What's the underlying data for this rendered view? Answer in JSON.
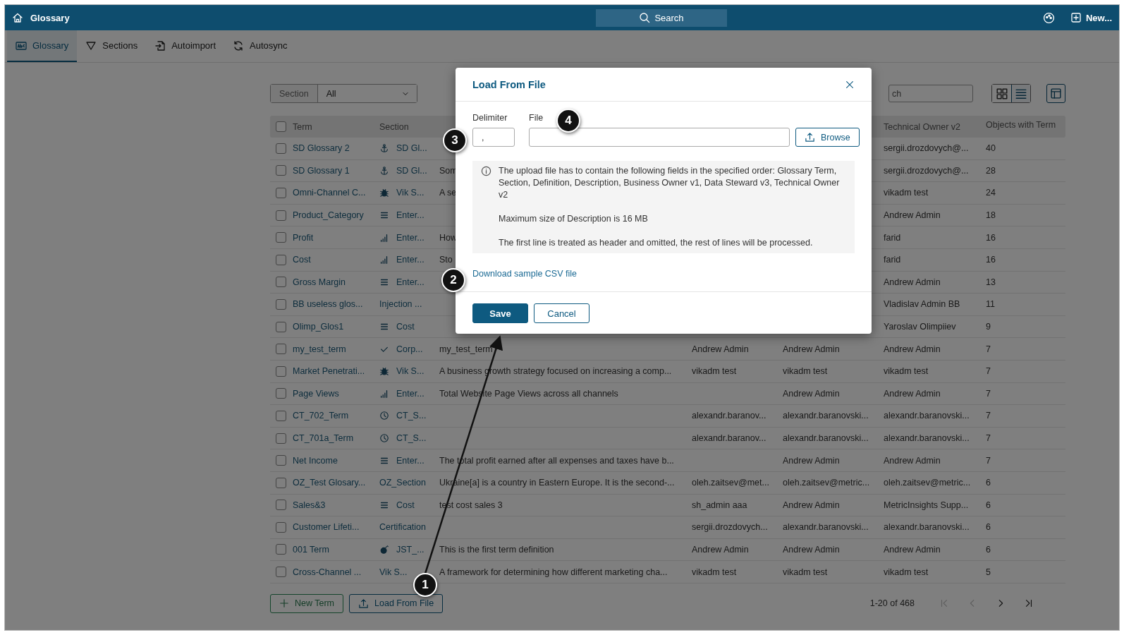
{
  "top_bar": {
    "title": "Glossary",
    "search_label": "Search",
    "new_label": "New..."
  },
  "tabs": [
    {
      "label": "Glossary",
      "selected": true
    },
    {
      "label": "Sections",
      "selected": false
    },
    {
      "label": "Autoimport",
      "selected": false
    },
    {
      "label": "Autosync",
      "selected": false
    }
  ],
  "filter": {
    "label": "Section",
    "value": "All"
  },
  "search": {
    "placeholder": "ch"
  },
  "view_toggle": [
    {
      "selected": false
    },
    {
      "selected": true
    }
  ],
  "table": {
    "select_all_checked": false,
    "columns": {
      "term": "Term",
      "section": "Section",
      "tech_owner": "Technical Owner v2",
      "objects": "Objects with Term"
    },
    "rows": [
      {
        "checked": false,
        "term": "SD Glossary 2",
        "kind": "anchor",
        "section": "SD Gl...",
        "tech_owner": "sergii.drozdovych@...",
        "objects": "40"
      },
      {
        "checked": false,
        "term": "SD Glossary 1",
        "kind": "anchor",
        "section": "SD Gl...",
        "definition": "Som",
        "tech_owner": "sergii.drozdovych@...",
        "objects": "28"
      },
      {
        "checked": false,
        "term": "Omni-Channel C...",
        "kind": "bug",
        "section": "Vik S...",
        "definition": "A se",
        "tech_owner": "vikadm test",
        "objects": "24"
      },
      {
        "checked": false,
        "term": "Product_Category",
        "kind": "lines",
        "section": "Enter...",
        "tech_owner": "Andrew Admin",
        "objects": "18"
      },
      {
        "checked": false,
        "term": "Profit",
        "kind": "bars",
        "section": "Enter...",
        "definition": "How",
        "tech_owner": "farid",
        "objects": "16"
      },
      {
        "checked": false,
        "term": "Cost",
        "kind": "bars",
        "section": "Enter...",
        "definition": "Sto",
        "tech_owner": "farid",
        "objects": "16"
      },
      {
        "checked": false,
        "term": "Gross Margin",
        "kind": "lines",
        "section": "Enter...",
        "tech_owner": "Andrew Admin",
        "objects": "13"
      },
      {
        "checked": false,
        "term": "BB useless glos...",
        "kind": "plain",
        "section": "Injection ...",
        "tech_owner": "Vladislav Admin BB",
        "objects": "11"
      },
      {
        "checked": false,
        "term": "Olimp_Glos1",
        "kind": "lines",
        "section": "Cost",
        "tech_owner": "Yaroslav Olimpiiev",
        "objects": "9"
      },
      {
        "checked": false,
        "term": "my_test_term",
        "kind": "check",
        "section": "Corp...",
        "definition": "my_test_term",
        "column_4": "Andrew Admin",
        "column_5": "Andrew Admin",
        "tech_owner": "Andrew Admin",
        "objects": "7"
      },
      {
        "checked": false,
        "term": "Market Penetrati...",
        "kind": "bug",
        "section": "Vik S...",
        "definition": "A business growth strategy focused on increasing a comp...",
        "column_4": "vikadm test",
        "column_5": "vikadm test",
        "tech_owner": "vikadm test",
        "objects": "7"
      },
      {
        "checked": false,
        "term": "Page Views",
        "kind": "bars",
        "section": "Enter...",
        "definition": "Total Website Page Views across all channels",
        "column_5": "Andrew Admin",
        "tech_owner": "Andrew Admin",
        "objects": "7"
      },
      {
        "checked": false,
        "term": "CT_702_Term",
        "kind": "clock",
        "section": "CT_S...",
        "column_4": "alexandr.baranov...",
        "column_5": "alexandr.baranovski...",
        "tech_owner": "alexandr.baranovski...",
        "objects": "7"
      },
      {
        "checked": false,
        "term": "CT_701a_Term",
        "kind": "clock",
        "section": "CT_S...",
        "column_4": "alexandr.baranov...",
        "column_5": "alexandr.baranovski...",
        "tech_owner": "alexandr.baranovski...",
        "objects": "7"
      },
      {
        "checked": false,
        "term": "Net Income",
        "kind": "lines",
        "section": "Enter...",
        "definition": "The total profit earned after all expenses and taxes have b...",
        "column_5": "Andrew Admin",
        "tech_owner": "Andrew Admin",
        "objects": "7"
      },
      {
        "checked": false,
        "term": "OZ_Test Glosary...",
        "kind": "plain",
        "section": "OZ_Section",
        "definition": "Ukraine[a] is a country in Eastern Europe. It is the second-...",
        "column_4": "oleh.zaitsev@met...",
        "column_5": "oleh.zaitsev@metric...",
        "tech_owner": "oleh.zaitsev@metric...",
        "objects": "6"
      },
      {
        "checked": false,
        "term": "Sales&3",
        "kind": "lines",
        "section": "Cost",
        "definition": "test cost sales 3",
        "column_4": "sh_admin aaa",
        "column_5": "Andrew Admin",
        "tech_owner": "MetricInsights Supp...",
        "objects": "6"
      },
      {
        "checked": false,
        "term": "Customer Lifeti...",
        "kind": "plain",
        "section": "Certification",
        "column_4": "sergii.drozdovych...",
        "column_5": "alexandr.baranovski...",
        "tech_owner": "alexandr.baranovski...",
        "objects": "6"
      },
      {
        "checked": false,
        "term": "001 Term",
        "kind": "bomb",
        "section": "JST_...",
        "definition": "This is the first term definition",
        "column_4": "Andrew Admin",
        "column_5": "Andrew Admin",
        "tech_owner": "Andrew Admin",
        "objects": "6"
      },
      {
        "checked": false,
        "term": "Cross-Channel ...",
        "kind": "plain",
        "section": "Vik S...",
        "definition": "A framework for determining how different marketing cha...",
        "column_4": "vikadm test",
        "column_5": "vikadm test",
        "tech_owner": "vikadm test",
        "objects": "5"
      }
    ]
  },
  "actions": [
    {
      "label": "New Term",
      "kind": "new"
    },
    {
      "label": "Load From File",
      "kind": "upload"
    }
  ],
  "pagination": {
    "range": "1-20 of 468",
    "first_disabled": true,
    "prev_disabled": true,
    "next_disabled": false,
    "last_disabled": false
  },
  "dialog": {
    "title": "Load From File",
    "delimiter_label": "Delimiter",
    "delimiter_value": ",",
    "file_label": "File",
    "browse_label": "Browse",
    "info": [
      "The upload file has to contain the following fields in the specified order: Glossary Term, Section, Definition, Description, Business Owner v1, Data Steward v3, Technical Owner v2",
      "Maximum size of Description is 16 MB",
      "The first line is treated as header and omitted, the rest of lines will be processed."
    ],
    "link": "Download sample CSV file",
    "save_label": "Save",
    "cancel_label": "Cancel"
  },
  "callouts": [
    {
      "number": "1"
    },
    {
      "number": "2"
    },
    {
      "number": "3"
    },
    {
      "number": "4"
    }
  ]
}
